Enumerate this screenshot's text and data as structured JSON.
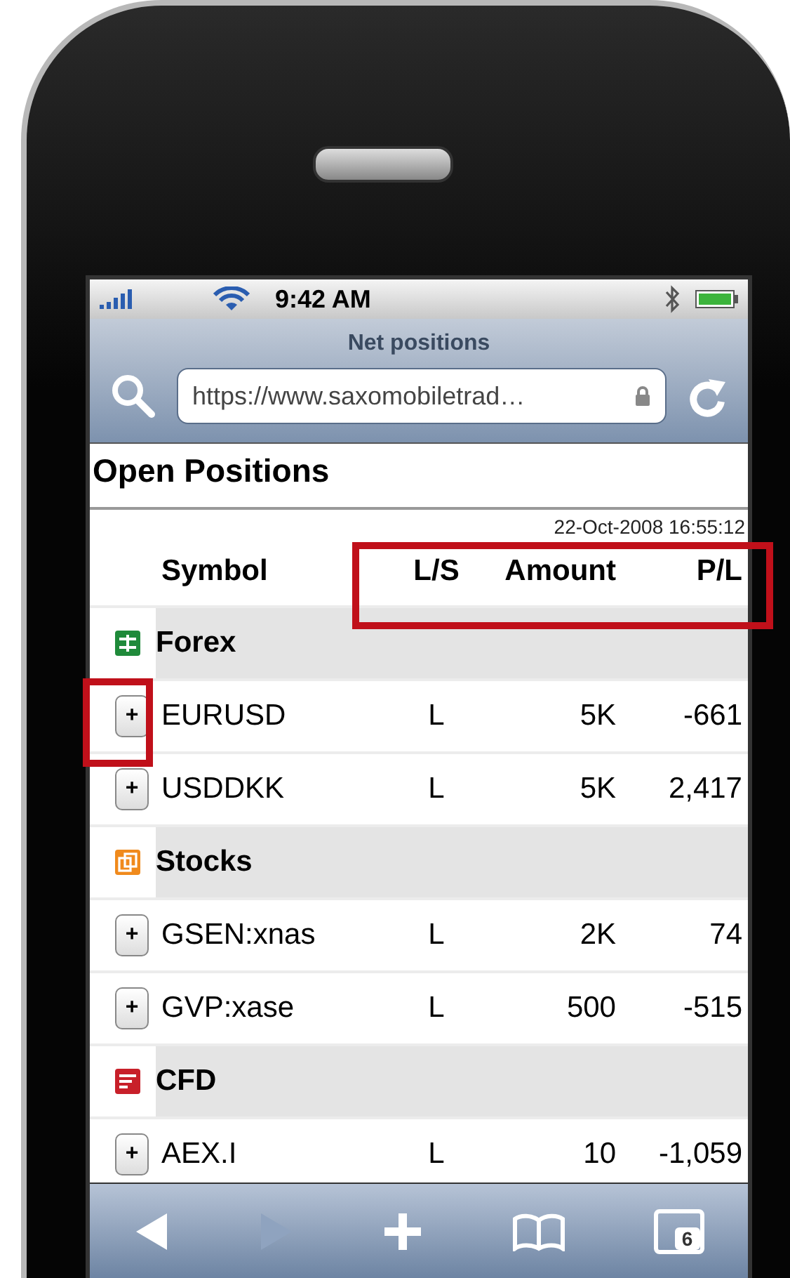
{
  "status_bar": {
    "time": "9:42 AM"
  },
  "browser": {
    "title": "Net positions",
    "url": "https://www.saxomobiletrad…"
  },
  "page": {
    "heading": "Open Positions",
    "timestamp": "22-Oct-2008 16:55:12",
    "columns": [
      "Symbol",
      "L/S",
      "Amount",
      "P/L"
    ],
    "groups": [
      {
        "name": "Forex",
        "kind": "forex",
        "rows": [
          {
            "button": "+",
            "symbol": "EURUSD",
            "ls": "L",
            "amount": "5K",
            "pl": "-661"
          },
          {
            "button": "+",
            "symbol": "USDDKK",
            "ls": "L",
            "amount": "5K",
            "pl": "2,417"
          }
        ]
      },
      {
        "name": "Stocks",
        "kind": "stocks",
        "rows": [
          {
            "button": "+",
            "symbol": "GSEN:xnas",
            "ls": "L",
            "amount": "2K",
            "pl": "74"
          },
          {
            "button": "+",
            "symbol": "GVP:xase",
            "ls": "L",
            "amount": "500",
            "pl": "-515"
          }
        ]
      },
      {
        "name": "CFD",
        "kind": "cfd",
        "rows": [
          {
            "button": "+",
            "symbol": "AEX.I",
            "ls": "L",
            "amount": "10",
            "pl": "-1,059"
          }
        ]
      }
    ]
  },
  "toolbar": {
    "tab_count": "6"
  }
}
